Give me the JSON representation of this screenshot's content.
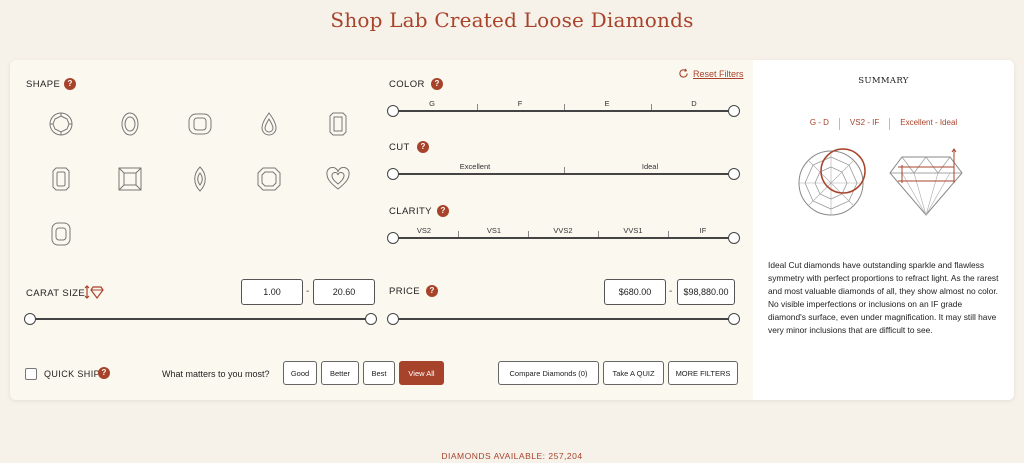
{
  "page": {
    "title": "Shop Lab Created Loose Diamonds"
  },
  "filters": {
    "reset_label": "Reset Filters",
    "shape": {
      "label": "SHAPE",
      "help": "?"
    },
    "color": {
      "label": "COLOR",
      "help": "?",
      "grades": [
        "G",
        "F",
        "E",
        "D"
      ]
    },
    "cut": {
      "label": "CUT",
      "help": "?",
      "grades": [
        "Excellent",
        "Ideal"
      ]
    },
    "clarity": {
      "label": "CLARITY",
      "help": "?",
      "grades": [
        "VS2",
        "VS1",
        "VVS2",
        "VVS1",
        "IF"
      ]
    },
    "carat": {
      "label": "CARAT SIZE",
      "min": "1.00",
      "max": "20.60",
      "dash": "-"
    },
    "price": {
      "label": "PRICE",
      "help": "?",
      "min": "$680.00",
      "max": "$98,880.00",
      "dash": "-"
    },
    "shapes": [
      "round-shape-icon",
      "oval-shape-icon",
      "cushion-shape-icon",
      "pear-shape-icon",
      "emerald-shape-icon",
      "radiant-shape-icon",
      "princess-shape-icon",
      "marquise-shape-icon",
      "asscher-shape-icon",
      "heart-shape-icon",
      "elongated-cushion-shape-icon"
    ]
  },
  "bottom_bar": {
    "quick_ship": "QUICK SHIP",
    "quick_ship_help": "?",
    "matters_label": "What matters to you most?",
    "buttons": [
      "Good",
      "Better",
      "Best",
      "View All"
    ],
    "compare": "Compare Diamonds (0)",
    "quiz": "Take A QUIZ",
    "more": "MORE FILTERS"
  },
  "summary": {
    "title": "SUMMARY",
    "tags": [
      "G - D",
      "VS2 - IF",
      "Excellent - Ideal"
    ],
    "text": "Ideal Cut diamonds have outstanding sparkle and flawless symmetry with perfect proportions to refract light. As the rarest and most valuable diamonds of all, they show almost no color. No visible imperfections or inclusions on an IF grade diamond's surface, even under magnification. It may still have very minor inclusions that are difficult to see."
  },
  "footer": {
    "available": "DIAMONDS AVAILABLE: 257,204"
  },
  "colors": {
    "accent": "#a8432b",
    "background": "#f6f1e9",
    "panel": "#fbf8ef"
  }
}
